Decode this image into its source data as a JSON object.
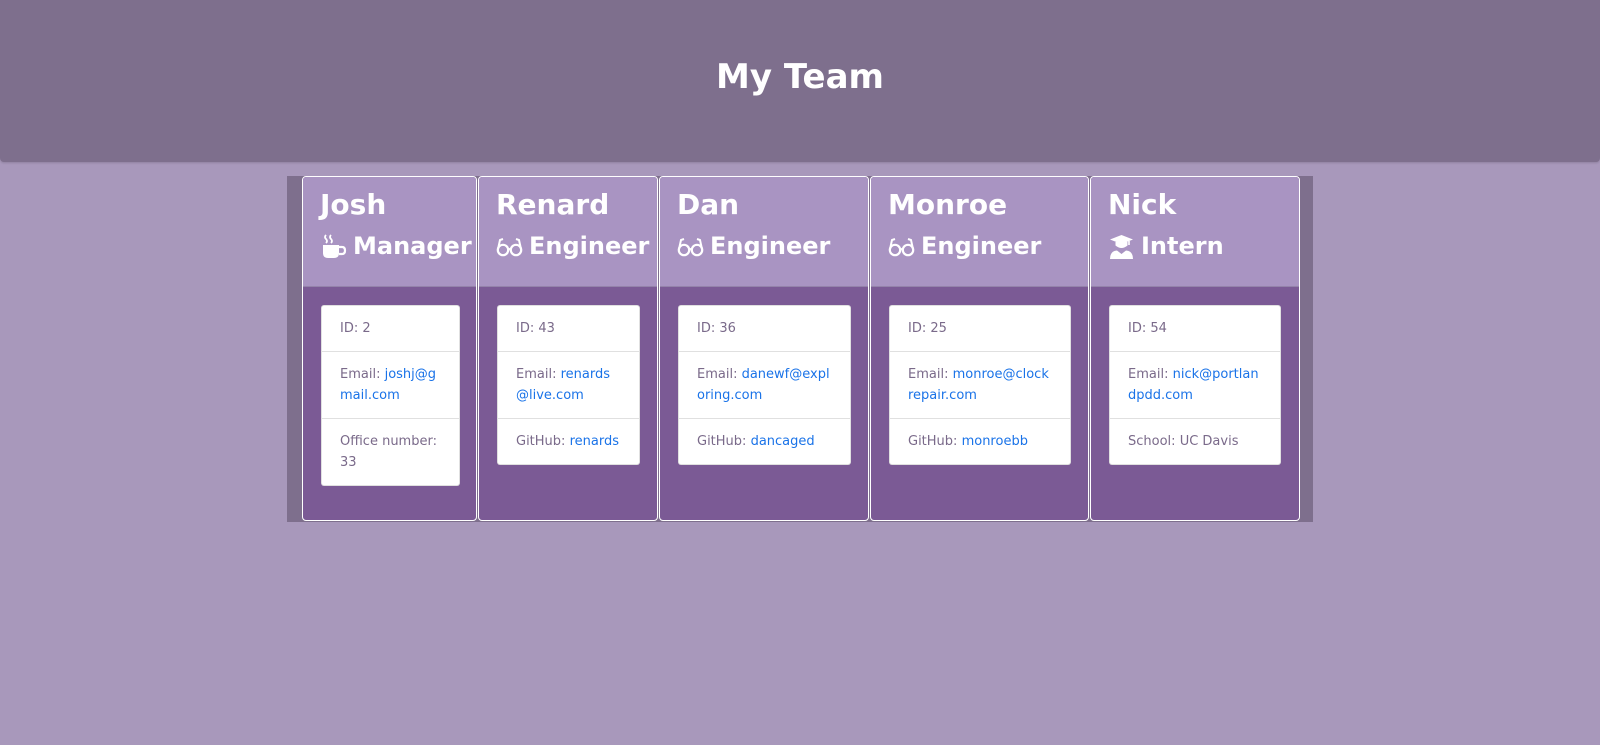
{
  "page_title": "My Team",
  "colors": {
    "background": "#a898bb",
    "header": "#7e6f8d",
    "card_header": "#a994c2",
    "card_body": "#7b5a95",
    "link": "#1a73e8",
    "info_text": "#7a6a8a"
  },
  "team": [
    {
      "name": "Josh",
      "role": "Manager",
      "icon": "coffee-mug-icon",
      "id_text": "ID: 2",
      "email_label": "Email:",
      "email": "joshj@gmail.com",
      "extra_label": "Office number:",
      "extra_value": "33"
    },
    {
      "name": "Renard",
      "role": "Engineer",
      "icon": "glasses-icon",
      "id_text": "ID: 43",
      "email_label": "Email:",
      "email": "renards@live.com",
      "extra_label": "GitHub:",
      "extra_value": "renards"
    },
    {
      "name": "Dan",
      "role": "Engineer",
      "icon": "glasses-icon",
      "id_text": "ID: 36",
      "email_label": "Email:",
      "email": "danewf@exploring.com",
      "extra_label": "GitHub:",
      "extra_value": "dancaged"
    },
    {
      "name": "Monroe",
      "role": "Engineer",
      "icon": "glasses-icon",
      "id_text": "ID: 25",
      "email_label": "Email:",
      "email": "monroe@clockrepair.com",
      "extra_label": "GitHub:",
      "extra_value": "monroebb"
    },
    {
      "name": "Nick",
      "role": "Intern",
      "icon": "graduate-icon",
      "id_text": "ID: 54",
      "email_label": "Email:",
      "email": "nick@portlandpdd.com",
      "extra_label": "School:",
      "extra_value": "UC Davis"
    }
  ]
}
